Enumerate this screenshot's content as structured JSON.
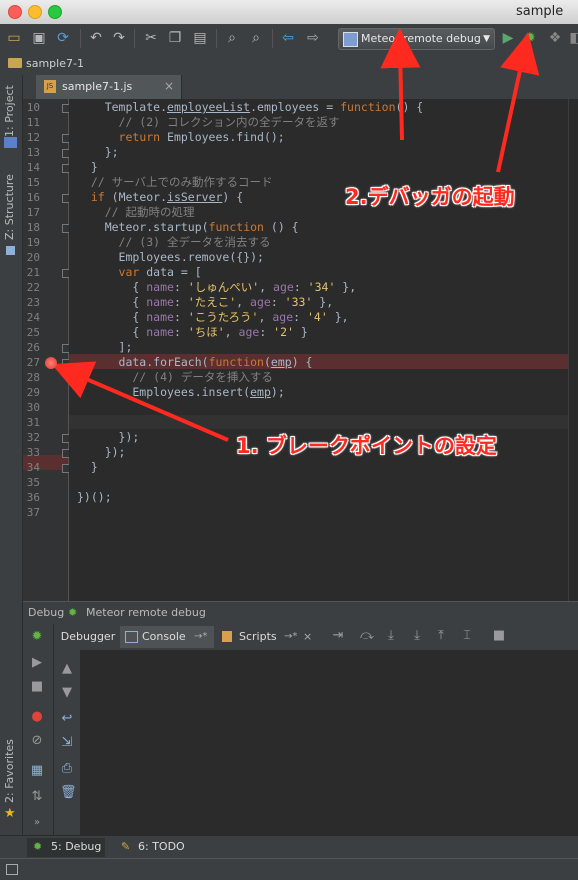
{
  "window": {
    "title": "sample"
  },
  "toolbar": {
    "run_config_label": "Meteor remote debug",
    "icons": [
      "open-folder-icon",
      "save-icon",
      "sync-icon",
      "undo-icon",
      "redo-icon",
      "cut-icon",
      "copy-icon",
      "paste-icon",
      "find-icon",
      "replace-icon",
      "back-icon",
      "forward-icon",
      "run-icon",
      "debug-icon",
      "coverage-icon"
    ]
  },
  "navbar": {
    "project": "sample7-1"
  },
  "left_strip": {
    "project_tab": "1: Project",
    "structure_tab": "Z: Structure",
    "favorites_tab": "2: Favorites"
  },
  "editor": {
    "tab_label": "sample7-1.js",
    "line_numbers": [
      "10",
      "11",
      "12",
      "13",
      "14",
      "15",
      "16",
      "17",
      "18",
      "19",
      "20",
      "21",
      "22",
      "23",
      "24",
      "25",
      "26",
      "27",
      "28",
      "29",
      "30",
      "31",
      "32",
      "33",
      "34",
      "35",
      "36",
      "37"
    ],
    "code": {
      "l10a": "    Template.",
      "l10b": "employeeList",
      "l10c": ".employees = ",
      "l10d": "function",
      "l10e": "() {",
      "l11": "      // (2) コレクション内の全データを返す",
      "l12a": "      ",
      "l12b": "return",
      "l12c": " Employees.find();",
      "l13": "    };",
      "l14": "  }",
      "l15": "  // サーバ上でのみ動作するコード",
      "l16a": "  ",
      "l16b": "if",
      "l16c": " (Meteor.",
      "l16d": "isServer",
      "l16e": ") {",
      "l17": "    // 起動時の処理",
      "l18a": "    Meteor.",
      "l18b": "startup",
      "l18c": "(",
      "l18d": "function",
      "l18e": " () {",
      "l19": "      // (3) 全データを消去する",
      "l20a": "      Employees.",
      "l20b": "remove",
      "l20c": "({});",
      "l21a": "      ",
      "l21b": "var",
      "l21c": " data = [",
      "l22a": "        { ",
      "l22b": "name",
      "l22c": ": ",
      "l22d": "'しゅんぺい'",
      "l22e": ", ",
      "l22f": "age",
      "l22g": ": ",
      "l22h": "'34'",
      "l22i": " },",
      "l23a": "        { ",
      "l23b": "name",
      "l23c": ": ",
      "l23d": "'たえこ'",
      "l23e": ", ",
      "l23f": "age",
      "l23g": ": ",
      "l23h": "'33'",
      "l23i": " },",
      "l24a": "        { ",
      "l24b": "name",
      "l24c": ": ",
      "l24d": "'こうたろう'",
      "l24e": ", ",
      "l24f": "age",
      "l24g": ": ",
      "l24h": "'4'",
      "l24i": " },",
      "l25a": "        { ",
      "l25b": "name",
      "l25c": ": ",
      "l25d": "'ちほ'",
      "l25e": ", ",
      "l25f": "age",
      "l25g": ": ",
      "l25h": "'2'",
      "l25i": " }",
      "l26": "      ];",
      "l27a": "      data.",
      "l27b": "forEach",
      "l27c": "(",
      "l27d": "function",
      "l27e": "(",
      "l27f": "emp",
      "l27g": ") {",
      "l28": "        // (4) データを挿入する",
      "l29a": "        Employees.",
      "l29b": "insert",
      "l29c": "(",
      "l29d": "emp",
      "l29e": ");",
      "l32": "      });",
      "l33": "    });",
      "l34": "  }",
      "l36": "})();"
    }
  },
  "debug": {
    "header_label": "Debug",
    "header_config": "Meteor remote debug",
    "tabs": {
      "debugger": "Debugger",
      "console": "Console",
      "console_suffix": "→*",
      "scripts": "Scripts",
      "scripts_suffix": "→*"
    }
  },
  "bottom_tabs": {
    "debug": "5: Debug",
    "todo": "6: TODO"
  },
  "annotations": {
    "breakpoint": "1. ブレークポイントの設定",
    "debugger": "2.デバッガの起動"
  },
  "colors": {
    "annotation": "#ff2a1f",
    "breakpoint": "#e0443a",
    "editor_bg": "#2b2b2b"
  }
}
